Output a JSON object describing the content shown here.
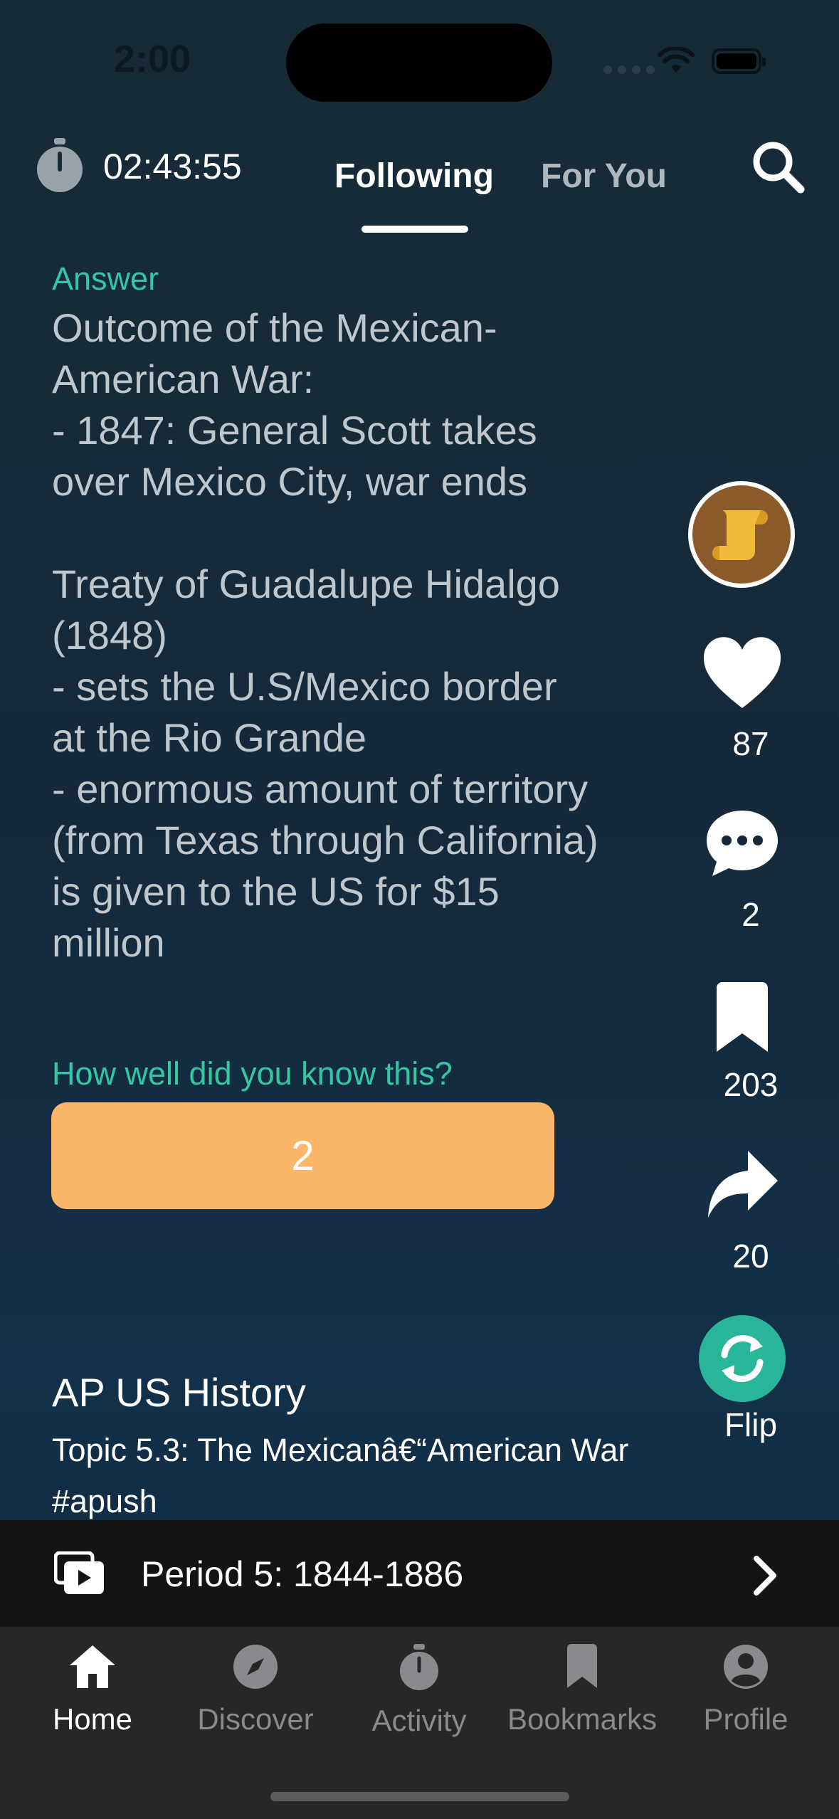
{
  "status_bar": {
    "time": "2:00"
  },
  "header": {
    "timer": "02:43:55",
    "tabs": [
      {
        "label": "Following",
        "active": true
      },
      {
        "label": "For You",
        "active": false
      }
    ]
  },
  "card": {
    "answer_label": "Answer",
    "answer_text": "Outcome of the Mexican-\nAmerican War:\n- 1847: General Scott takes\nover Mexico City, war ends\n\nTreaty of Guadalupe Hidalgo\n(1848)\n- sets the U.S/Mexico border\nat the Rio Grande\n- enormous amount of territory\n(from Texas through California)\nis given to the US for $15\nmillion",
    "prompt": "How well did you know this?",
    "rating": "2",
    "course": "AP US History",
    "topic": "Topic 5.3: The Mexicanâ€“American War #apush"
  },
  "rail": {
    "likes": "87",
    "comments": "2",
    "bookmarks": "203",
    "shares": "20",
    "flip": "Flip"
  },
  "playlist": {
    "label": "Period 5: 1844-1886"
  },
  "tabbar": {
    "items": [
      {
        "label": "Home",
        "icon": "home-icon",
        "active": true
      },
      {
        "label": "Discover",
        "icon": "compass-icon",
        "active": false
      },
      {
        "label": "Activity",
        "icon": "stopwatch-icon",
        "active": false
      },
      {
        "label": "Bookmarks",
        "icon": "bookmark-icon",
        "active": false
      },
      {
        "label": "Profile",
        "icon": "person-icon",
        "active": false
      }
    ]
  },
  "colors": {
    "accent_green": "#35c7a3",
    "rating_orange": "#fbb669",
    "flip_green": "#28b598"
  }
}
